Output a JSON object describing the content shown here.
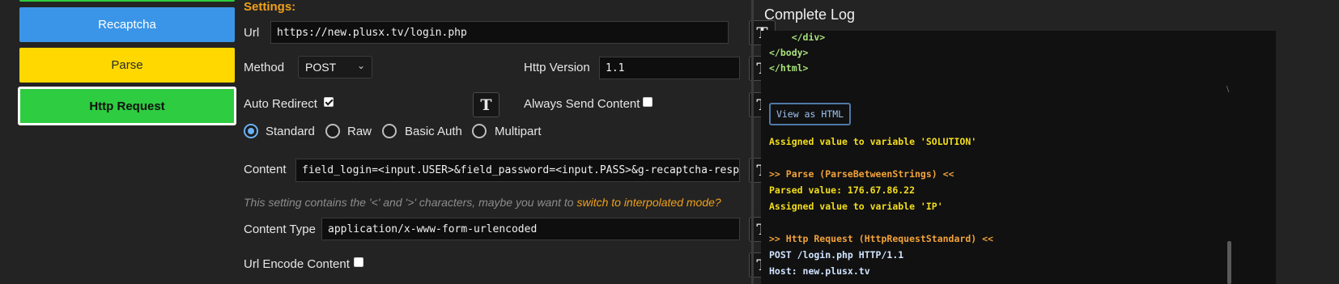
{
  "blocks": {
    "recaptcha": "Recaptcha",
    "parse": "Parse",
    "http_request": "Http Request"
  },
  "settings": {
    "title": "Settings:",
    "url_label": "Url",
    "url_value": "https://new.plusx.tv/login.php",
    "method_label": "Method",
    "method_value": "POST",
    "http_version_label": "Http Version",
    "http_version_value": "1.1",
    "auto_redirect_label": "Auto Redirect",
    "auto_redirect_checked": true,
    "always_send_content_label": "Always Send Content",
    "always_send_content_checked": false,
    "request_types": [
      "Standard",
      "Raw",
      "Basic Auth",
      "Multipart"
    ],
    "request_type_selected": "Standard",
    "content_label": "Content",
    "content_value": "field_login=<input.USER>&field_password=<input.PASS>&g-recaptcha-response",
    "hint_text": "This setting contains the '<' and '>' characters, maybe you want to ",
    "hint_link": "switch to interpolated mode?",
    "content_type_label": "Content Type",
    "content_type_value": "application/x-www-form-urlencoded",
    "url_encode_label": "Url Encode Content",
    "url_encode_checked": false,
    "interp_button_glyph": "T"
  },
  "log": {
    "title": "Complete Log",
    "lines_top": [
      "    </div>",
      "</body>",
      "</html>"
    ],
    "view_html_button": "View as HTML",
    "assigned_solution": "Assigned value to variable 'SOLUTION'",
    "parse_header": ">> Parse (ParseBetweenStrings) <<",
    "parsed_value": "Parsed value: 176.67.86.22",
    "assigned_ip": "Assigned value to variable 'IP'",
    "http_header": ">> Http Request (HttpRequestStandard) <<",
    "request_line": "POST /login.php HTTP/1.1",
    "host_line": "Host: new.plusx.tv"
  },
  "colors": {
    "accent_orange": "#f0a01a",
    "block_blue": "#3a95e8",
    "block_yellow": "#ffd800",
    "block_green": "#2ecc40"
  }
}
